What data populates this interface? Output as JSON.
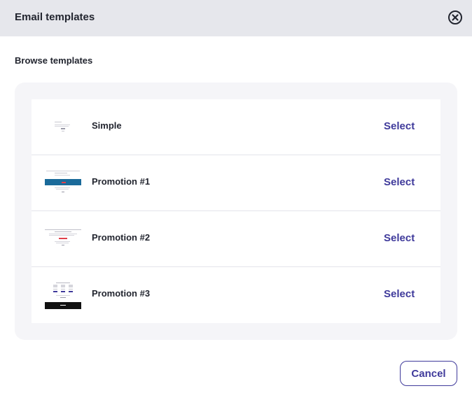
{
  "header": {
    "title": "Email templates"
  },
  "section": {
    "label": "Browse templates"
  },
  "templates": [
    {
      "name": "Simple",
      "select_label": "Select",
      "thumbnail_icon": "simple-template-thumbnail"
    },
    {
      "name": "Promotion #1",
      "select_label": "Select",
      "thumbnail_icon": "promotion-1-template-thumbnail"
    },
    {
      "name": "Promotion #2",
      "select_label": "Select",
      "thumbnail_icon": "promotion-2-template-thumbnail"
    },
    {
      "name": "Promotion #3",
      "select_label": "Select",
      "thumbnail_icon": "promotion-3-template-thumbnail"
    }
  ],
  "footer": {
    "cancel_label": "Cancel"
  },
  "colors": {
    "accent": "#3f3a9b",
    "header_bg": "#e6e7ec",
    "panel_bg": "#f5f5f8",
    "promo1_banner": "#1a6a9a",
    "promo2_button": "#e0404a",
    "promo3_footer": "#111111"
  }
}
